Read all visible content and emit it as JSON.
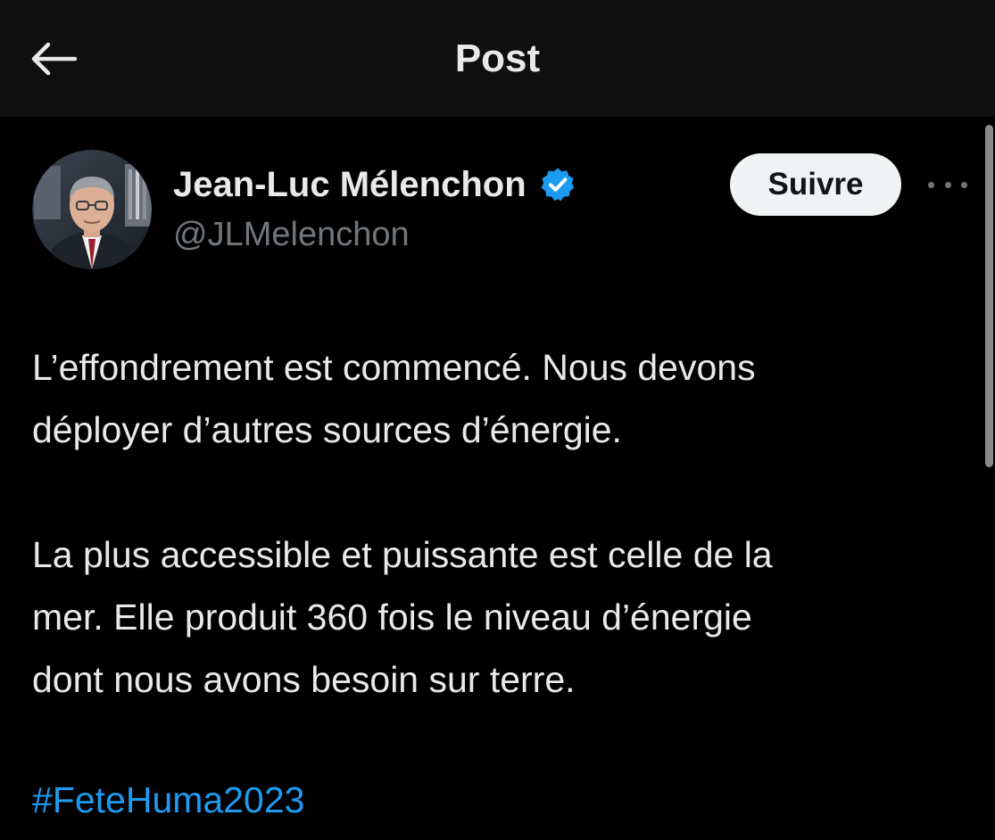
{
  "header": {
    "title": "Post",
    "back_icon": "arrow-left-icon"
  },
  "author": {
    "name": "Jean-Luc Mélenchon",
    "handle": "@JLMelenchon",
    "verified_icon": "verified-badge-icon",
    "verified_color": "#1d9bf0"
  },
  "actions": {
    "follow_label": "Suivre",
    "more_icon": "more-options-icon"
  },
  "post": {
    "paragraphs": [
      "L’effondrement est commencé. Nous devons\ndéployer d’autres sources d’énergie.",
      "La plus accessible et puissante est celle de la\nmer. Elle produit 360 fois le niveau d’énergie\ndont nous avons besoin sur terre."
    ],
    "hashtag": "#FeteHuma2023"
  },
  "colors": {
    "background": "#000000",
    "header_background": "#0f0f0f",
    "text": "#e7e9ea",
    "secondary_text": "#71767b",
    "link": "#1d9bf0"
  }
}
